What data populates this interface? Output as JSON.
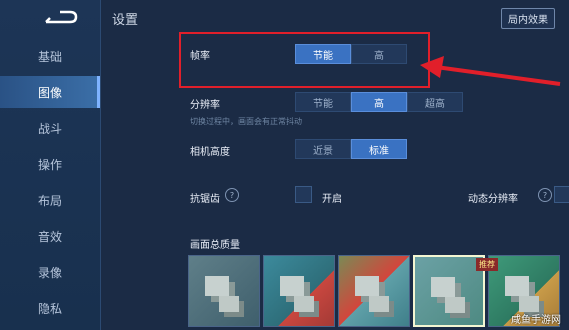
{
  "page": {
    "title": "设置",
    "battle_effect_button": "局内效果"
  },
  "sidebar": {
    "items": [
      {
        "label": "基础",
        "active": false
      },
      {
        "label": "图像",
        "active": true
      },
      {
        "label": "战斗",
        "active": false
      },
      {
        "label": "操作",
        "active": false
      },
      {
        "label": "布局",
        "active": false
      },
      {
        "label": "音效",
        "active": false
      },
      {
        "label": "录像",
        "active": false
      },
      {
        "label": "隐私",
        "active": false
      }
    ]
  },
  "frame_rate": {
    "label": "帧率",
    "options": [
      "节能",
      "高"
    ],
    "selected": "节能"
  },
  "resolution": {
    "label": "分辨率",
    "options": [
      "节能",
      "高",
      "超高"
    ],
    "selected": "高",
    "hint": "切换过程中，画面会有正常抖动"
  },
  "camera_height": {
    "label": "相机高度",
    "options": [
      "近景",
      "标准"
    ],
    "selected": "标准"
  },
  "anti_aliasing": {
    "label": "抗锯齿",
    "toggle_label": "开启",
    "enabled": false
  },
  "dynamic_resolution": {
    "label": "动态分辨率",
    "enabled": false
  },
  "overall_quality": {
    "label": "画面总质量",
    "thumbnails": 5,
    "selected_index": 3,
    "recommend_badge": "推荐"
  },
  "watermark": "咸鱼手游网",
  "colors": {
    "background": "#1b2b45",
    "selected_option": "#3a72c2",
    "highlight_box": "#e11f2a",
    "arrow": "#e11f2a"
  }
}
